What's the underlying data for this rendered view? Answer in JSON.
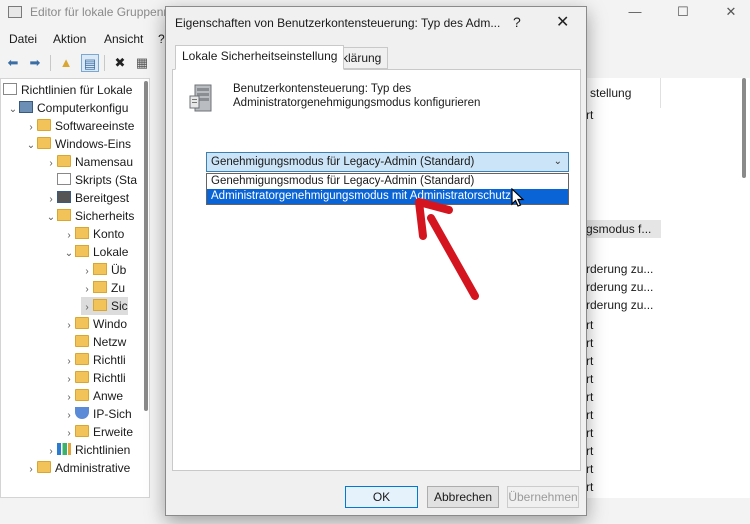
{
  "main_window": {
    "title": "Editor für lokale Gruppenrichtlinien",
    "menu": [
      "Datei",
      "Aktion",
      "Ansicht",
      "?"
    ],
    "window_controls": {
      "minimize": "—",
      "maximize": "☐",
      "close": "✕"
    }
  },
  "tree": [
    {
      "label": "Richtlinien für Lokale",
      "icon": "doc-icon",
      "chev": ""
    },
    {
      "label": "Computerkonfigu",
      "icon": "computer-icon",
      "chev": "⌄"
    },
    {
      "label": "Softwareeinste",
      "icon": "folder-icon",
      "chev": "›"
    },
    {
      "label": "Windows-Eins",
      "icon": "folder-icon",
      "chev": "⌄"
    },
    {
      "label": "Namensau",
      "icon": "folder-icon",
      "chev": "›"
    },
    {
      "label": "Skripts (Sta",
      "icon": "script-icon",
      "chev": ""
    },
    {
      "label": "Bereitgest",
      "icon": "printer-icon",
      "chev": "›"
    },
    {
      "label": "Sicherheits",
      "icon": "security-folder-icon",
      "chev": "⌄"
    },
    {
      "label": "Konto",
      "icon": "folder-lock-icon",
      "chev": "›"
    },
    {
      "label": "Lokale",
      "icon": "folder-lock-icon",
      "chev": "⌄"
    },
    {
      "label": "Üb",
      "icon": "folder-lock-icon",
      "chev": "›"
    },
    {
      "label": "Zu",
      "icon": "folder-lock-icon",
      "chev": "›"
    },
    {
      "label": "Sic",
      "icon": "folder-lock-icon",
      "chev": "›"
    },
    {
      "label": "Windo",
      "icon": "folder-icon",
      "chev": "›"
    },
    {
      "label": "Netzw",
      "icon": "folder-icon",
      "chev": ""
    },
    {
      "label": "Richtli",
      "icon": "folder-icon",
      "chev": "›"
    },
    {
      "label": "Richtli",
      "icon": "folder-icon",
      "chev": "›"
    },
    {
      "label": "Anwe",
      "icon": "folder-icon",
      "chev": "›"
    },
    {
      "label": "IP-Sich",
      "icon": "shield-icon",
      "chev": "›"
    },
    {
      "label": "Erweite",
      "icon": "folder-icon",
      "chev": "›"
    },
    {
      "label": "Richtlinien",
      "icon": "chart-icon",
      "chev": "›"
    },
    {
      "label": "Administrative",
      "icon": "folder-icon",
      "chev": "›"
    }
  ],
  "right_panel": {
    "header": "stellung",
    "rows": [
      "rt",
      "",
      "",
      "",
      "",
      "",
      "gsmodus f...",
      "",
      "rderung zu...",
      "rderung zu...",
      "rderung zu...",
      "rt",
      "rt",
      "rt",
      "rt",
      "rt",
      "rt",
      "rt",
      "rt",
      "rt",
      "rt"
    ]
  },
  "dialog": {
    "title": "Eigenschaften von Benutzerkontensteuerung: Typ des Adm...",
    "help": "?",
    "close": "✕",
    "tabs": [
      "Lokale Sicherheitseinstellung",
      "Erklärung"
    ],
    "policy_text": "Benutzerkontensteuerung: Typ des Administratorgenehmigungsmodus konfigurieren",
    "combo_value": "Genehmigungsmodus für Legacy-Admin (Standard)",
    "options": [
      "Genehmigungsmodus für Legacy-Admin (Standard)",
      "Administratorgenehmigungsmodus mit Administratorschutz"
    ],
    "buttons": {
      "ok": "OK",
      "cancel": "Abbrechen",
      "apply": "Übernehmen"
    }
  },
  "colors": {
    "highlight": "#0a64d6",
    "combo_bg": "#cce4f7",
    "arrow": "#d4151f"
  }
}
